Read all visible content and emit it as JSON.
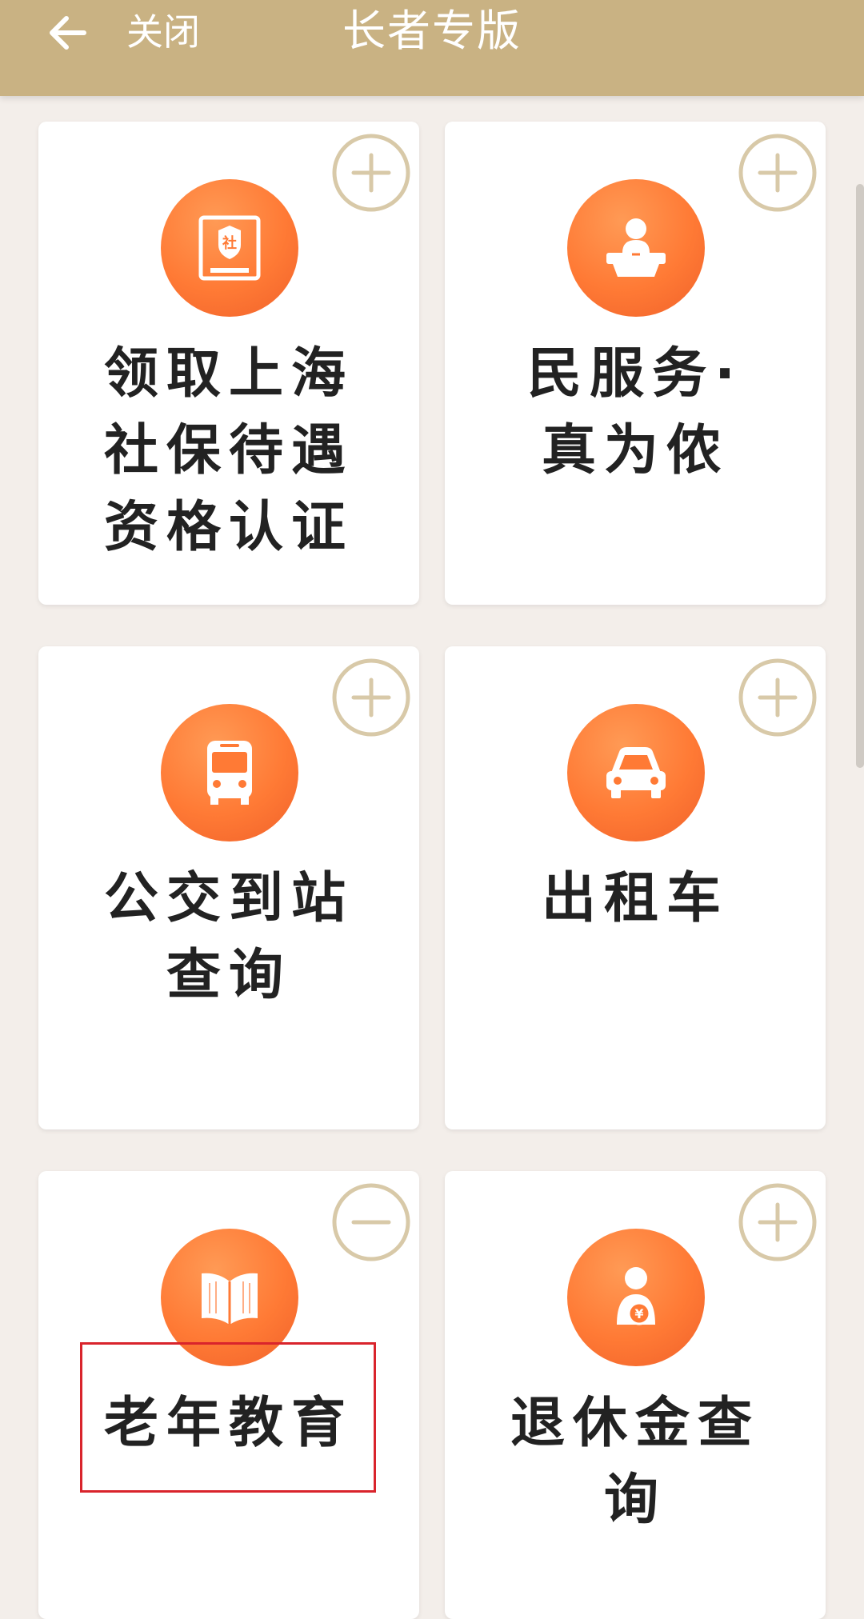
{
  "header": {
    "close_label": "关闭",
    "title": "长者专版"
  },
  "services": [
    {
      "label": "领取上海\n社保待遇\n资格认证",
      "icon": "social-security-icon",
      "state": "add"
    },
    {
      "label": "民服务·\n真为侬",
      "icon": "service-desk-icon",
      "state": "add"
    },
    {
      "label": "公交到站\n查询",
      "icon": "bus-icon",
      "state": "add"
    },
    {
      "label": "出租车",
      "icon": "taxi-icon",
      "state": "add"
    },
    {
      "label": "老年教育",
      "icon": "open-book-icon",
      "state": "remove"
    },
    {
      "label": "退休金查\n询",
      "icon": "pension-icon",
      "state": "add"
    }
  ],
  "colors": {
    "header_bg": "#c9b283",
    "accent_orange": "#ff7a35",
    "toggle_gold": "#d8c9a8",
    "highlight_red": "#d9242c",
    "page_bg": "#f3eeea"
  }
}
